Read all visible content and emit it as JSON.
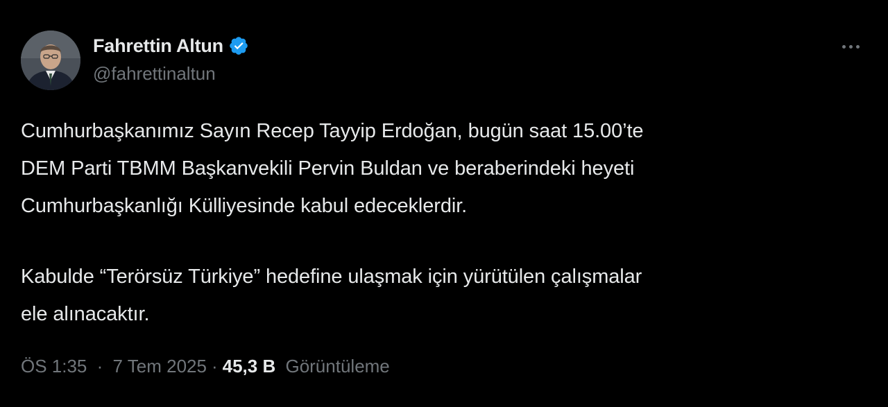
{
  "author": {
    "display_name": "Fahrettin Altun",
    "handle": "@fahrettinaltun",
    "verified": true,
    "verified_icon": "verified-badge-icon",
    "verified_color": "#1d9bf0"
  },
  "menu": {
    "icon": "more-horizontal-icon"
  },
  "tweet": {
    "lines": [
      "Cumhurbaşkanımız Sayın Recep Tayyip Erdoğan, bugün saat 15.00’te",
      "DEM Parti TBMM Başkanvekili Pervin Buldan ve beraberindeki heyeti",
      "Cumhurbaşkanlığı Külliyesinde kabul edeceklerdir.",
      "",
      "Kabulde “Terörsüz Türkiye” hedefine ulaşmak için yürütülen çalışmalar",
      "ele alınacaktır."
    ]
  },
  "meta": {
    "time": "ÖS 1:35",
    "separator": "·",
    "date": "7 Tem 2025",
    "views_count": "45,3 B",
    "views_label": "Görüntüleme"
  },
  "colors": {
    "background": "#000000",
    "primary_text": "#e7e9ea",
    "secondary_text": "#71767b",
    "accent": "#1d9bf0"
  }
}
